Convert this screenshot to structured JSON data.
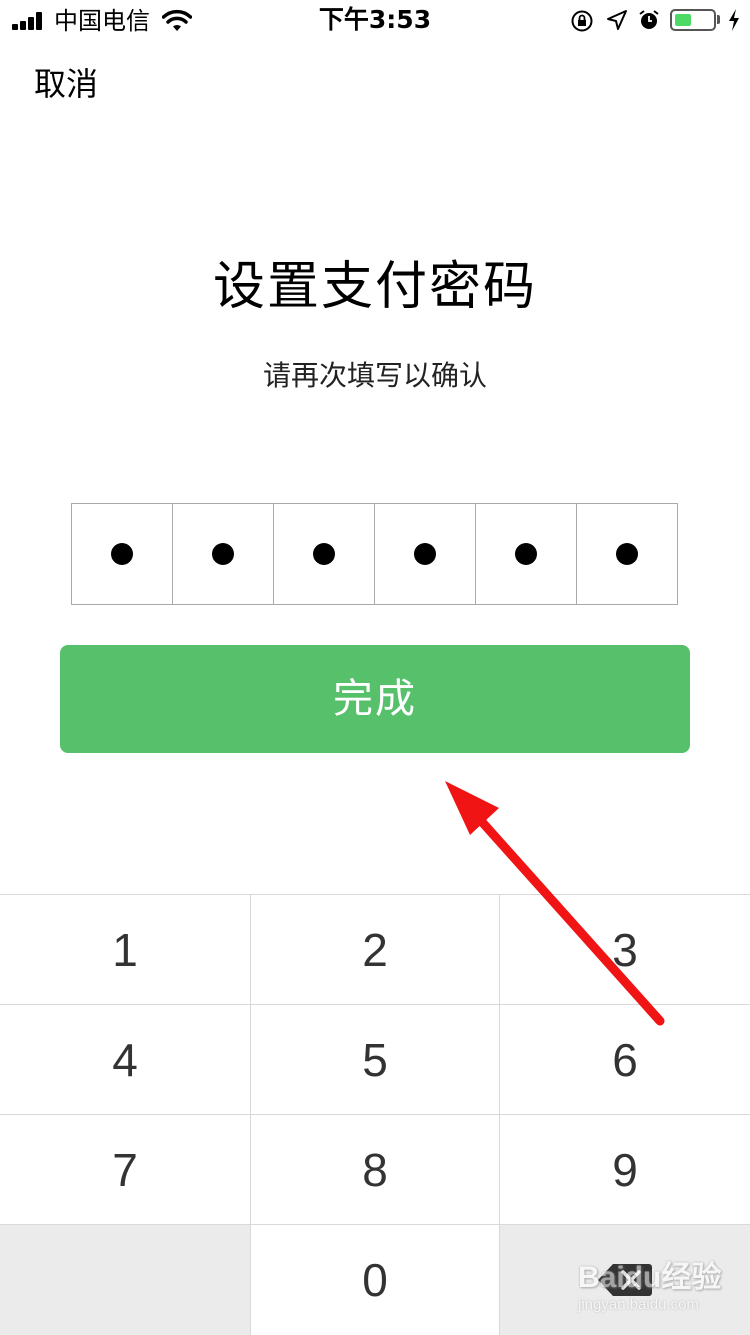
{
  "status_bar": {
    "carrier": "中国电信",
    "time": "下午3:53",
    "battery_level": 0.45,
    "icons": [
      "signal-icon",
      "wifi-icon",
      "rotation-lock-icon",
      "location-icon",
      "alarm-icon",
      "battery-icon",
      "charging-icon"
    ]
  },
  "nav": {
    "cancel_label": "取消"
  },
  "header": {
    "title": "设置支付密码",
    "subtitle": "请再次填写以确认"
  },
  "pin": {
    "length": 6,
    "filled": 6
  },
  "actions": {
    "done_label": "完成"
  },
  "keypad": {
    "keys": [
      "1",
      "2",
      "3",
      "4",
      "5",
      "6",
      "7",
      "8",
      "9",
      "",
      "0",
      "delete"
    ],
    "labels": {
      "k1": "1",
      "k2": "2",
      "k3": "3",
      "k4": "4",
      "k5": "5",
      "k6": "6",
      "k7": "7",
      "k8": "8",
      "k9": "9",
      "k0": "0"
    }
  },
  "colors": {
    "primary_button": "#57c06a",
    "annotation_arrow": "#f01414",
    "keypad_gray": "#ebebeb",
    "battery_fill": "#4cd964"
  },
  "watermark": {
    "main": "Baidu经验",
    "sub": "jingyan.baidu.com"
  }
}
